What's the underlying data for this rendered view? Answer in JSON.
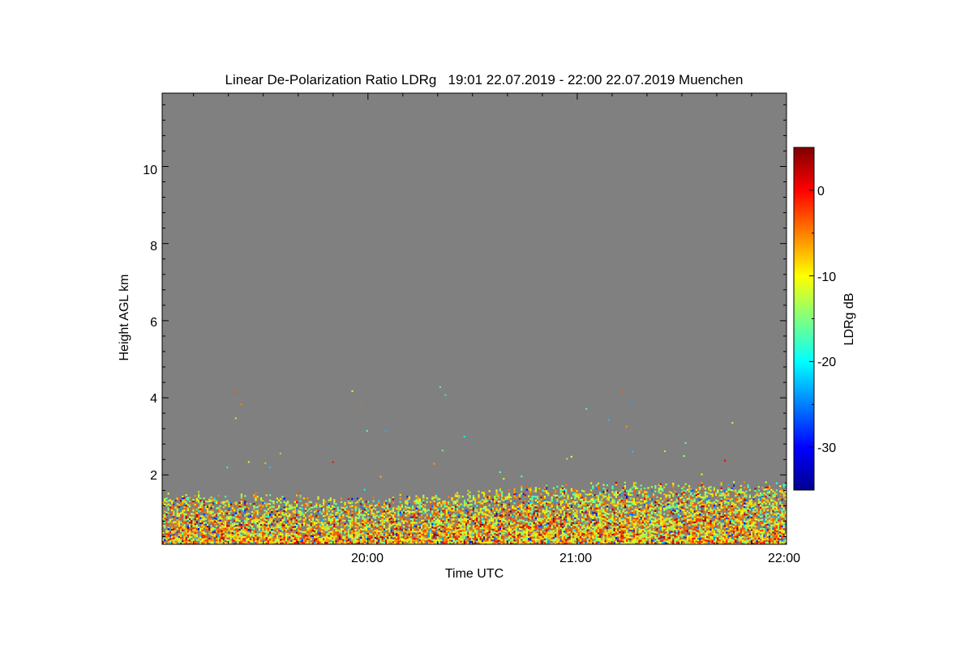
{
  "chart_data": {
    "type": "heatmap",
    "title": "Linear De-Polarization Ratio LDRg   19:01 22.07.2019 - 22:00 22.07.2019 Muenchen",
    "xlabel": "Time UTC",
    "ylabel": "Height AGL km",
    "colorbar_label": "LDRg dB",
    "x_range": [
      "19:01",
      "22:00"
    ],
    "ylim": [
      0.2,
      11.9
    ],
    "x_ticks": [
      {
        "time": "20:00",
        "label": "20:00"
      },
      {
        "time": "21:00",
        "label": "21:00"
      },
      {
        "time": "22:00",
        "label": "22:00"
      }
    ],
    "y_ticks": [
      {
        "value": 2,
        "label": "2"
      },
      {
        "value": 4,
        "label": "4"
      },
      {
        "value": 6,
        "label": "6"
      },
      {
        "value": 8,
        "label": "8"
      },
      {
        "value": 10,
        "label": "10"
      }
    ],
    "color_range": [
      -35,
      5
    ],
    "colorbar_ticks": [
      {
        "value": 0,
        "label": "0"
      },
      {
        "value": -10,
        "label": "-10"
      },
      {
        "value": -20,
        "label": "-20"
      },
      {
        "value": -30,
        "label": "-30"
      }
    ],
    "colormap": "jet",
    "no_signal_color": "#808080",
    "layer_top_km": [
      {
        "time": "19:01",
        "km": 1.5
      },
      {
        "time": "19:30",
        "km": 1.4
      },
      {
        "time": "20:00",
        "km": 1.3
      },
      {
        "time": "20:30",
        "km": 1.5
      },
      {
        "time": "21:00",
        "km": 1.7
      },
      {
        "time": "21:30",
        "km": 1.7
      },
      {
        "time": "22:00",
        "km": 1.7
      }
    ]
  }
}
